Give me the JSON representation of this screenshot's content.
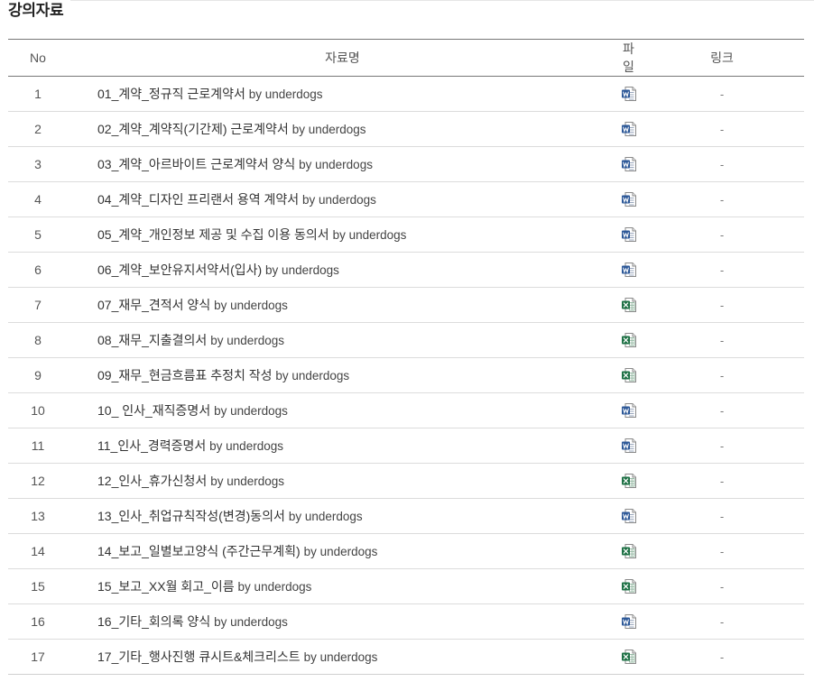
{
  "section": {
    "title": "강의자료"
  },
  "table": {
    "headers": {
      "no": "No",
      "name": "자료명",
      "file": "파일",
      "link": "링크"
    },
    "rows": [
      {
        "no": "1",
        "title": "01_계약_정규직 근로계약서",
        "author": "by underdogs",
        "file_icon": "word-doc-icon",
        "link": "-"
      },
      {
        "no": "2",
        "title": "02_계약_계약직(기간제) 근로계약서",
        "author": "by underdogs",
        "file_icon": "word-doc-icon",
        "link": "-"
      },
      {
        "no": "3",
        "title": "03_계약_아르바이트 근로계약서 양식",
        "author": "by underdogs",
        "file_icon": "word-doc-icon",
        "link": "-"
      },
      {
        "no": "4",
        "title": "04_계약_디자인 프리랜서 용역 계약서",
        "author": "by underdogs",
        "file_icon": "word-doc-icon",
        "link": "-"
      },
      {
        "no": "5",
        "title": "05_계약_개인정보 제공 및 수집 이용 동의서",
        "author": "by underdogs",
        "file_icon": "word-doc-icon",
        "link": "-"
      },
      {
        "no": "6",
        "title": "06_계약_보안유지서약서(입사)",
        "author": "by underdogs",
        "file_icon": "word-doc-icon",
        "link": "-"
      },
      {
        "no": "7",
        "title": "07_재무_견적서 양식",
        "author": "by underdogs",
        "file_icon": "excel-sheet-icon",
        "link": "-"
      },
      {
        "no": "8",
        "title": "08_재무_지출결의서",
        "author": "by underdogs",
        "file_icon": "excel-sheet-icon",
        "link": "-"
      },
      {
        "no": "9",
        "title": "09_재무_현금흐름표 추정치 작성",
        "author": "by underdogs",
        "file_icon": "excel-sheet-icon",
        "link": "-"
      },
      {
        "no": "10",
        "title": "10_ 인사_재직증명서",
        "author": "by underdogs",
        "file_icon": "word-doc-icon",
        "link": "-"
      },
      {
        "no": "11",
        "title": "11_인사_경력증명서",
        "author": "by underdogs",
        "file_icon": "word-doc-icon",
        "link": "-"
      },
      {
        "no": "12",
        "title": "12_인사_휴가신청서",
        "author": "by underdogs",
        "file_icon": "excel-sheet-icon",
        "link": "-"
      },
      {
        "no": "13",
        "title": "13_인사_취업규칙작성(변경)동의서",
        "author": "by underdogs",
        "file_icon": "word-doc-icon",
        "link": "-"
      },
      {
        "no": "14",
        "title": "14_보고_일별보고양식 (주간근무계획)",
        "author": "by underdogs",
        "file_icon": "excel-sheet-icon",
        "link": "-"
      },
      {
        "no": "15",
        "title": "15_보고_XX월 회고_이름",
        "author": "by underdogs",
        "file_icon": "excel-sheet-icon",
        "link": "-"
      },
      {
        "no": "16",
        "title": "16_기타_회의록 양식",
        "author": "by underdogs",
        "file_icon": "word-doc-icon",
        "link": "-"
      },
      {
        "no": "17",
        "title": "17_기타_행사진행 큐시트&체크리스트",
        "author": "by underdogs",
        "file_icon": "excel-sheet-icon",
        "link": "-"
      }
    ]
  },
  "colors": {
    "word_badge": "#2b5797",
    "excel_badge": "#1e7145",
    "header_rule": "#777777",
    "row_rule": "#dcdcdc"
  }
}
